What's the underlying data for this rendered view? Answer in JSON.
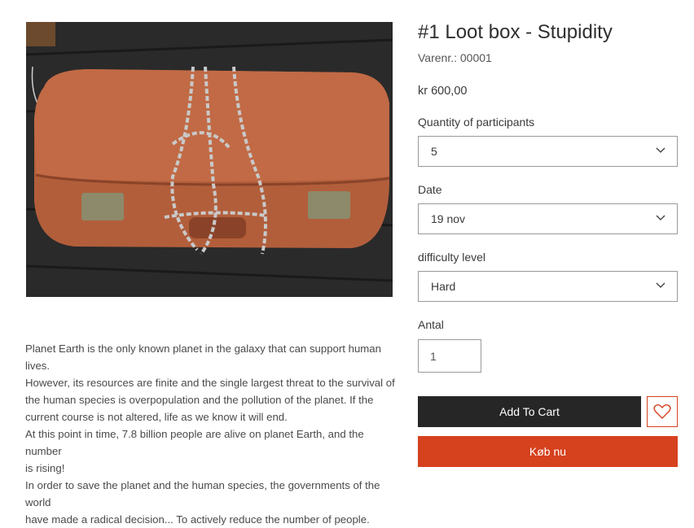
{
  "product": {
    "title": "#1 Loot box - Stupidity",
    "sku": "Varenr.: 00001",
    "price": "kr 600,00"
  },
  "options": [
    {
      "label": "Quantity of participants",
      "value": "5"
    },
    {
      "label": "Date",
      "value": "19 nov"
    },
    {
      "label": "difficulty level",
      "value": "Hard"
    }
  ],
  "quantity": {
    "label": "Antal",
    "value": "1"
  },
  "buttons": {
    "add_to_cart": "Add To Cart",
    "buy_now": "Køb nu"
  },
  "description": {
    "lines": [
      "Planet Earth is the only known planet in the galaxy that can support human lives.",
      "However, its resources are finite and the single largest threat to the survival of",
      "the human species is overpopulation and the pollution of the planet. If the",
      "current course is not altered, life as we know it will end.",
      "At this point in time, 7.8 billion people are alive on planet Earth, and the number",
      "is rising!",
      "In order to save the planet and the human species, the governments of the world",
      "have made a radical decision... To actively reduce the number of people."
    ]
  },
  "image": {
    "icon": "suitcase-with-chains-photo"
  },
  "colors": {
    "accent": "#d6411e",
    "dark_button": "#262626"
  }
}
